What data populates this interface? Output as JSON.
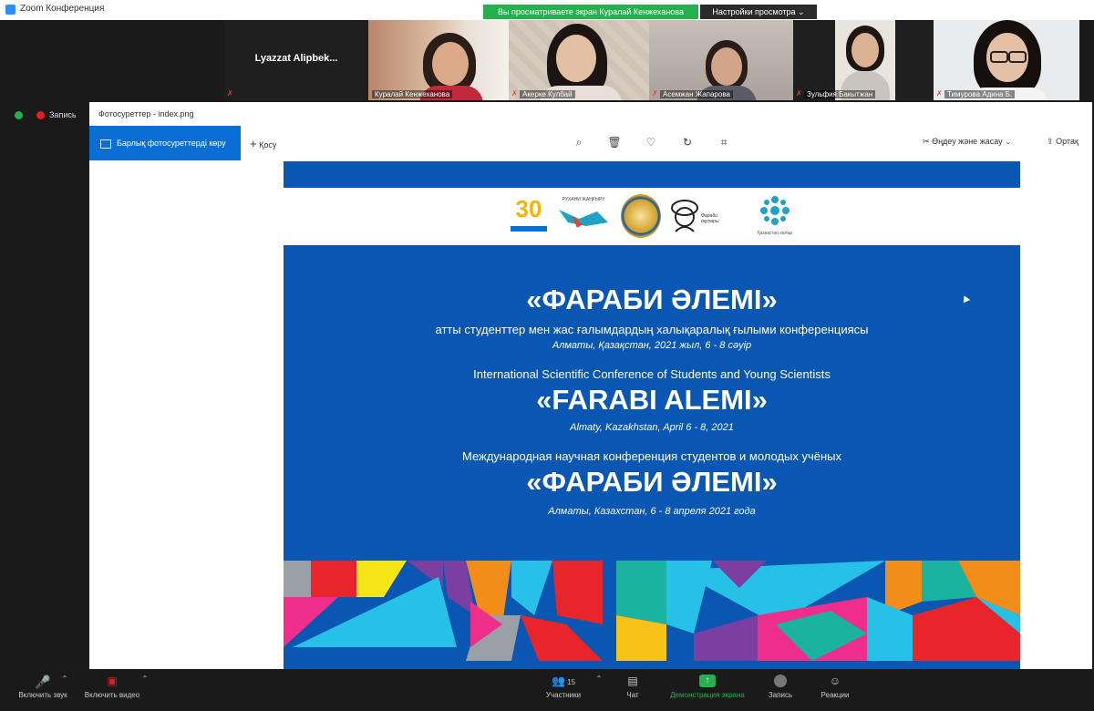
{
  "window": {
    "title": "Zoom Конференция"
  },
  "banner": {
    "sharing_text": "Вы просматриваете экран Куралай Кенжеханова",
    "view_options": "Настройки просмотра ⌄"
  },
  "participants": [
    {
      "name": "Lyazzat  Alipbek..."
    },
    {
      "name": "Куралай Кенжеханова"
    },
    {
      "name": "Акерке Кулбай"
    },
    {
      "name": "Асемжан Жапарова"
    },
    {
      "name": "Зульфия Бакытжан"
    },
    {
      "name": "Тимурова Адина Б."
    }
  ],
  "recording": {
    "label": "Запись"
  },
  "photos_app": {
    "title": "Фотосуреттер - index.png",
    "see_all_label": "Барлық фотосуреттерді көру",
    "add_label": "Қосу",
    "edit_create_label": "Өңдеу және жасау",
    "share_label": "Ортақ"
  },
  "slide": {
    "logos": {
      "anniversary": "30",
      "text1": "РУХАНИ ЖАҢҒЫРУ",
      "text2": "Фараби оқулары",
      "text3": "Қазақстан халқы"
    },
    "kz_title": "«ФАРАБИ ӘЛЕМІ»",
    "kz_subtitle": "атты студенттер мен жас ғалымдардың халықаралық ғылыми конференциясы",
    "kz_place": "Алматы, Қазақстан, 2021 жыл, 6 - 8 сәуір",
    "en_subtitle": "International Scientific Conference of Students and Young Scientists",
    "en_title": "«FARABI ALEMI»",
    "en_place": "Almaty, Kazakhstan, April 6 - 8, 2021",
    "ru_subtitle": "Международная научная конференция студентов и молодых учёных",
    "ru_title": "«ФАРАБИ ӘЛЕМІ»",
    "ru_place": "Алматы, Казахстан, 6 - 8 апреля 2021 года"
  },
  "bottombar": {
    "audio": "Включить звук",
    "video": "Включить видео",
    "participants": "Участники",
    "participants_count": "15",
    "chat": "Чат",
    "share": "Демонстрация экрана",
    "record": "Запись",
    "reactions": "Реакции"
  },
  "colors": {
    "slide_blue": "#0957b3",
    "zoom_green": "#22b14c",
    "accent_blue": "#0a6fd4"
  }
}
